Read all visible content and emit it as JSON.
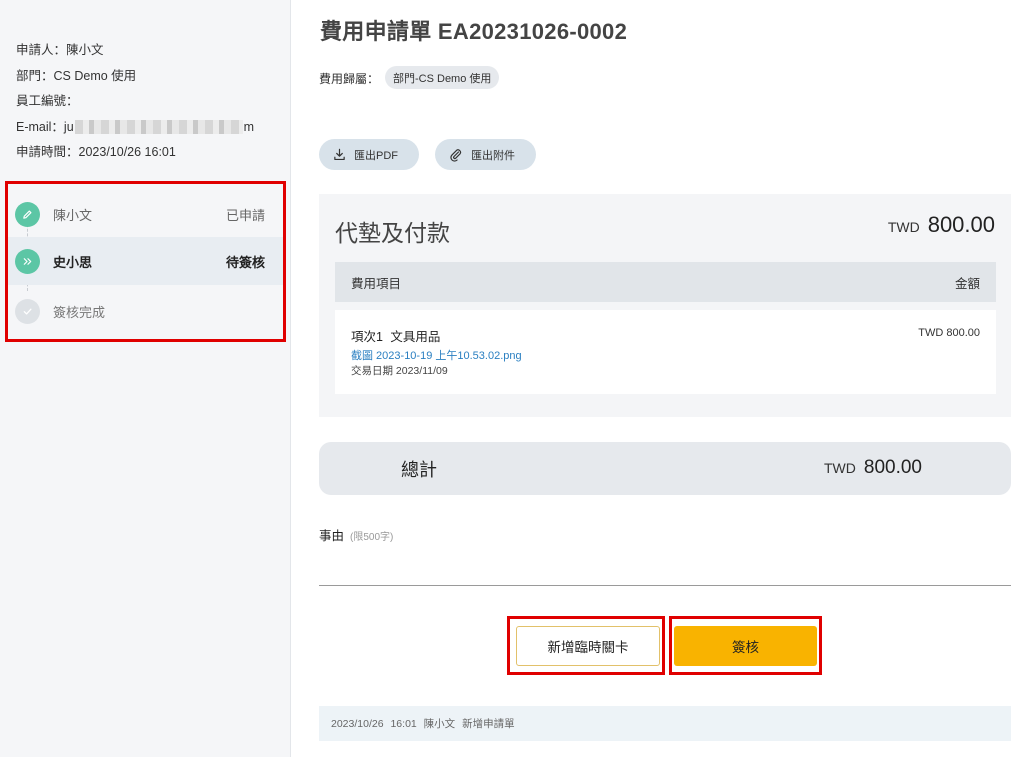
{
  "applicant": {
    "applicant_label": "申請人：",
    "applicant_name": "陳小文",
    "dept_label": "部門：",
    "dept_value": "CS Demo 使用",
    "employee_no_label": "員工編號：",
    "employee_no_value": "",
    "email_label": "E-mail：",
    "email_prefix": "ju",
    "email_suffix": "m",
    "apply_time_label": "申請時間：",
    "apply_time_value": "2023/10/26 16:01"
  },
  "workflow": {
    "steps": [
      {
        "name": "陳小文",
        "status": "已申請",
        "icon": "pencil-icon"
      },
      {
        "name": "史小思",
        "status": "待簽核",
        "icon": "double-chevron-right-icon"
      },
      {
        "name": "簽核完成",
        "status": "",
        "icon": "check-icon"
      }
    ]
  },
  "header": {
    "title": "費用申請單 EA20231026-0002",
    "dept_belong_label": "費用歸屬：",
    "dept_belong_chip": "部門-CS Demo 使用"
  },
  "actions": {
    "export_pdf": "匯出PDF",
    "export_attachments": "匯出附件"
  },
  "expense": {
    "category_title": "代墊及付款",
    "currency": "TWD",
    "total": "800.00",
    "columns": [
      "費用項目",
      "金額"
    ],
    "items": [
      {
        "title": "項次1 文具用品",
        "amount": "TWD 800.00",
        "attachment": "截圖 2023-10-19 上午10.53.02.png",
        "date": "交易日期 2023/11/09"
      }
    ]
  },
  "summary": {
    "label": "總計",
    "currency": "TWD",
    "amount": "800.00"
  },
  "reason": {
    "label": "事由",
    "limit": "(限500字)"
  },
  "buttons": {
    "add_temp_checkpoint": "新增臨時關卡",
    "approve": "簽核"
  },
  "log": {
    "entry": "2023/10/26 16:01 陳小文 新增申請單"
  },
  "colors": {
    "accent_green": "#5cc6a5",
    "primary_yellow": "#f9b300",
    "highlight_red": "#e00000",
    "link_blue": "#2a7fc1"
  }
}
